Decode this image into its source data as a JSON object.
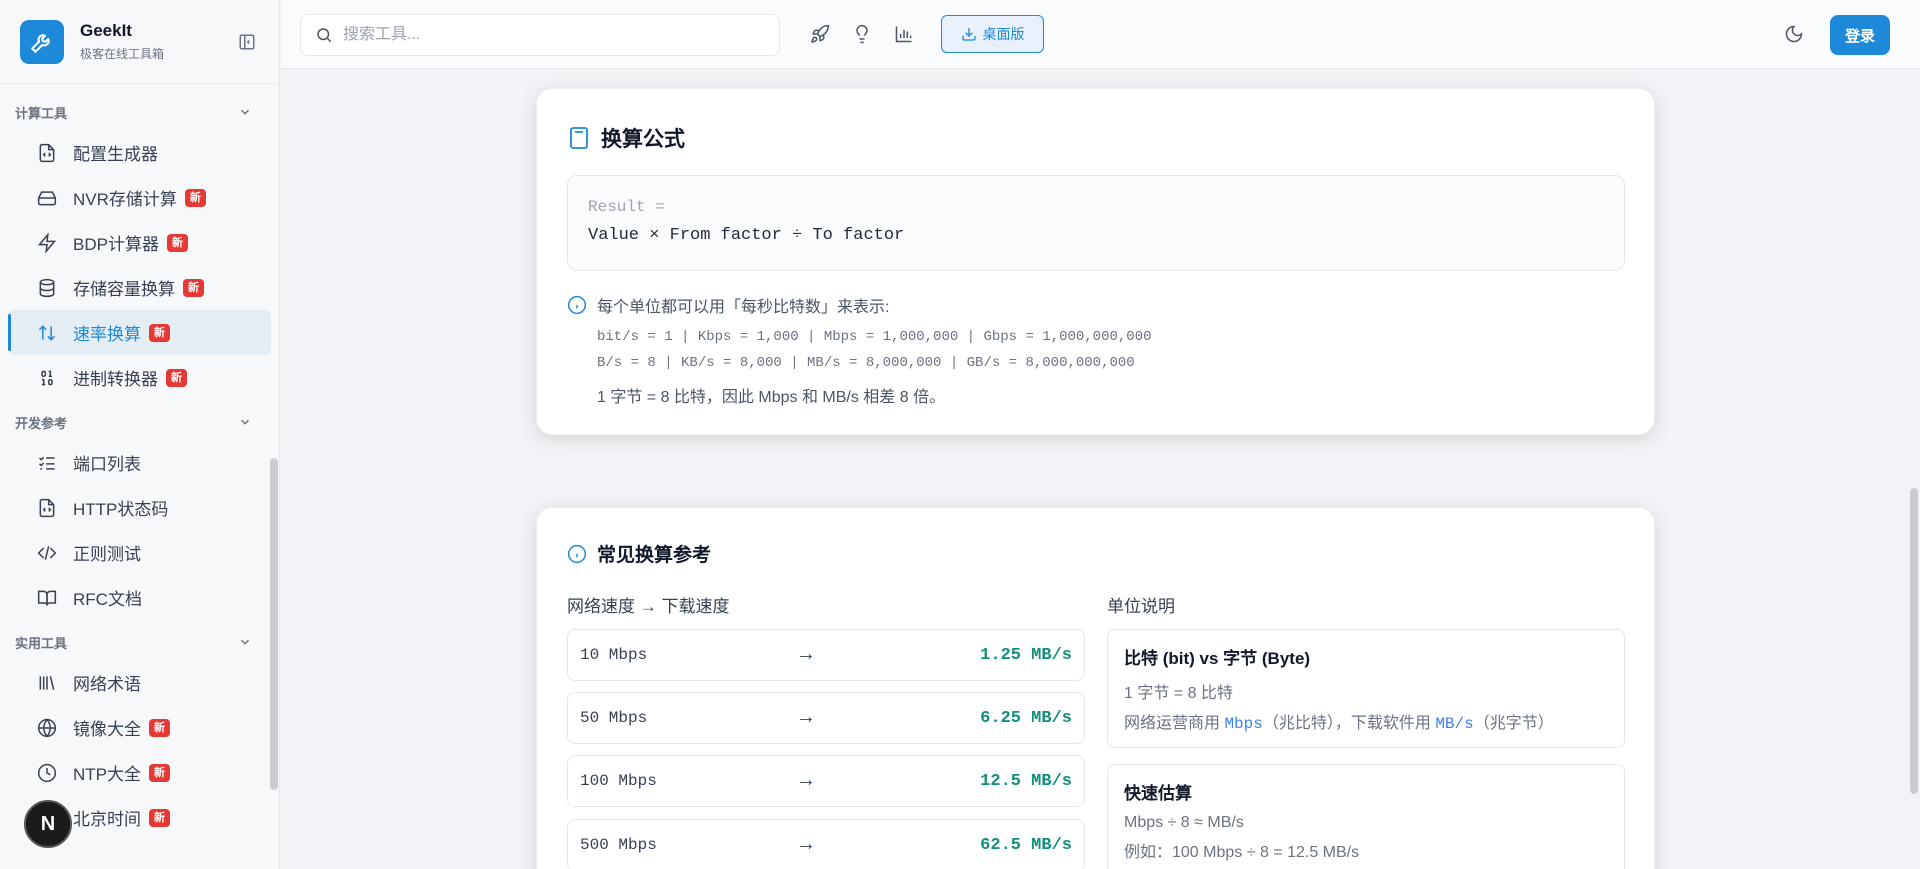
{
  "brand": {
    "name": "GeekIt",
    "subtitle": "极客在线工具箱"
  },
  "search": {
    "placeholder": "搜索工具..."
  },
  "header": {
    "desktop_label": "桌面版",
    "login_label": "登录"
  },
  "sidebar": {
    "sections": [
      {
        "title": "计算工具",
        "items": [
          {
            "label": "配置生成器",
            "icon": "file-code-icon",
            "badge": ""
          },
          {
            "label": "NVR存储计算",
            "icon": "hard-drive-icon",
            "badge": "新"
          },
          {
            "label": "BDP计算器",
            "icon": "lightning-icon",
            "badge": "新"
          },
          {
            "label": "存储容量换算",
            "icon": "database-icon",
            "badge": "新"
          },
          {
            "label": "速率换算",
            "icon": "arrows-up-down-icon",
            "badge": "新",
            "active": true
          },
          {
            "label": "进制转换器",
            "icon": "binary-icon",
            "badge": "新"
          }
        ]
      },
      {
        "title": "开发参考",
        "items": [
          {
            "label": "端口列表",
            "icon": "list-checks-icon",
            "badge": ""
          },
          {
            "label": "HTTP状态码",
            "icon": "file-code-icon",
            "badge": ""
          },
          {
            "label": "正则测试",
            "icon": "code-icon",
            "badge": ""
          },
          {
            "label": "RFC文档",
            "icon": "book-icon",
            "badge": ""
          }
        ]
      },
      {
        "title": "实用工具",
        "items": [
          {
            "label": "网络术语",
            "icon": "library-icon",
            "badge": ""
          },
          {
            "label": "镜像大全",
            "icon": "globe-icon",
            "badge": "新"
          },
          {
            "label": "NTP大全",
            "icon": "clock-icon",
            "badge": "新"
          },
          {
            "label": "北京时间",
            "icon": "clock-icon",
            "badge": "新"
          }
        ]
      }
    ]
  },
  "avatar": {
    "letter": "N"
  },
  "formula_card": {
    "title": "换算公式",
    "line1": "Result =",
    "line2": "Value × From factor ÷ To factor",
    "note_head": "每个单位都可以用「每秒比特数」来表示:",
    "bits_line": "bit/s = 1 | Kbps = 1,000 | Mbps = 1,000,000 | Gbps = 1,000,000,000",
    "bytes_line": "B/s = 8 | KB/s = 8,000 | MB/s = 8,000,000 | GB/s = 8,000,000,000",
    "foot": "1 字节 = 8 比特，因此 Mbps 和 MB/s 相差 8 倍。"
  },
  "reference_card": {
    "title": "常见换算参考",
    "left_head": "网络速度 → 下载速度",
    "right_head": "单位说明",
    "arrow": "→",
    "rows": [
      {
        "from": "10 Mbps",
        "to": "1.25 MB/s"
      },
      {
        "from": "50 Mbps",
        "to": "6.25 MB/s"
      },
      {
        "from": "100 Mbps",
        "to": "12.5 MB/s"
      },
      {
        "from": "500 Mbps",
        "to": "62.5 MB/s"
      }
    ],
    "unit_box1": {
      "title": "比特 (bit) vs 字节 (Byte)",
      "line1": "1 字节 = 8 比特",
      "line2_pre": "网络运营商用 ",
      "line2_code1": "Mbps",
      "line2_mid": "（兆比特），下载软件用 ",
      "line2_code2": "MB/s",
      "line2_post": "（兆字节）"
    },
    "unit_box2": {
      "title": "快速估算",
      "line1": "Mbps ÷ 8 ≈ MB/s",
      "line2": "例如：100 Mbps ÷ 8 = 12.5 MB/s"
    }
  },
  "colors": {
    "accent": "#1e88d9",
    "badge": "#e53935",
    "result_green": "#12907a"
  }
}
